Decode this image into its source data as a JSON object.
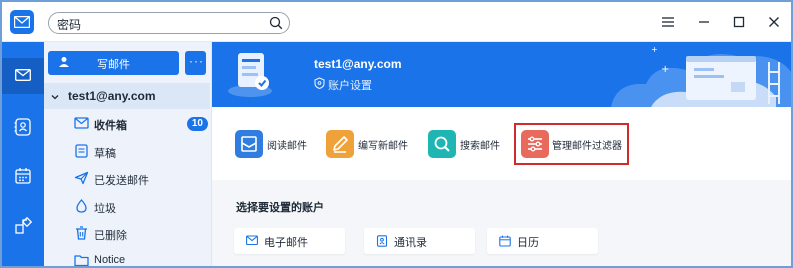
{
  "search": {
    "value": "密码",
    "icon": "search-icon"
  },
  "window_controls": [
    "menu-icon",
    "minimize-icon",
    "maximize-icon",
    "close-icon"
  ],
  "rail": {
    "items": [
      "mail-icon",
      "contacts-icon",
      "calendar-icon",
      "apps-icon"
    ],
    "active": "mail-icon"
  },
  "sidebar": {
    "compose_label": "写邮件",
    "more_label": "···",
    "account": "test1@any.com",
    "folders": [
      {
        "label": "收件箱",
        "icon": "inbox-icon",
        "badge": "10",
        "bold": true
      },
      {
        "label": "草稿",
        "icon": "draft-icon"
      },
      {
        "label": "已发送邮件",
        "icon": "sent-icon"
      },
      {
        "label": "垃圾",
        "icon": "spam-icon"
      },
      {
        "label": "已删除",
        "icon": "trash-icon"
      },
      {
        "label": "Notice",
        "icon": "folder-icon"
      }
    ]
  },
  "banner": {
    "account_name": "test1@any.com",
    "subtitle": "账户设置"
  },
  "quick_actions": [
    {
      "label": "阅读邮件",
      "icon": "read-mail-icon",
      "color": "#2f7de1"
    },
    {
      "label": "编写新邮件",
      "icon": "compose-pencil-icon",
      "color": "#f0a23a"
    },
    {
      "label": "搜索邮件",
      "icon": "search-mail-icon",
      "color": "#1fb5b2"
    },
    {
      "label": "管理邮件过滤器",
      "icon": "filter-sliders-icon",
      "color": "#e86a5c",
      "highlighted": true
    }
  ],
  "setup": {
    "title": "选择要设置的账户",
    "cards": [
      {
        "label": "电子邮件",
        "icon": "email-icon"
      },
      {
        "label": "通讯录",
        "icon": "address-book-icon"
      },
      {
        "label": "日历",
        "icon": "calendar-icon"
      }
    ]
  },
  "colors": {
    "accent": "#1a73e8",
    "highlight": "#d02b2b",
    "sidebar_bg": "#eef3fb"
  }
}
